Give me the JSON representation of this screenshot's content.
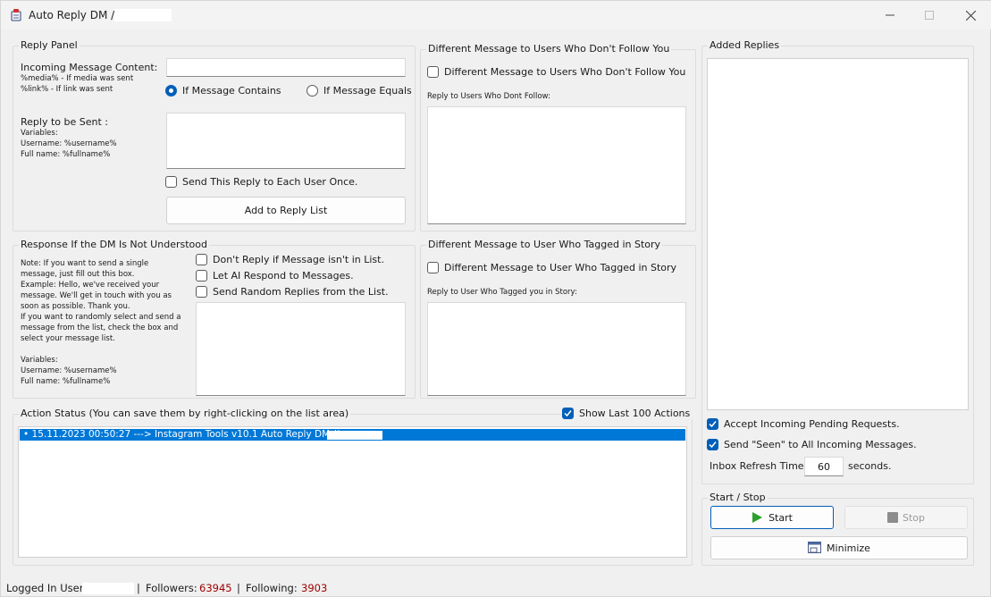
{
  "window": {
    "title": "Auto Reply DM //",
    "minimize_icon": "minimize-icon",
    "maximize_icon": "maximize-icon",
    "close_icon": "close-icon"
  },
  "reply_panel": {
    "title": "Reply Panel",
    "incoming_label": "Incoming Message Content:",
    "incoming_note1": "%media% - If media was sent",
    "incoming_note2": "%link% - If link was sent",
    "incoming_value": "",
    "radio_contains": "If Message Contains",
    "radio_equals": "If Message Equals",
    "radio_selected": "contains",
    "reply_label": "Reply to be Sent :",
    "reply_note1": "Variables:",
    "reply_note2": "Username: %username%",
    "reply_note3": "Full name: %fullname%",
    "reply_value": "",
    "send_once_label": "Send This Reply to Each User Once.",
    "send_once_checked": false,
    "add_button": "Add to Reply List"
  },
  "not_understood": {
    "title": "Response If the DM Is Not Understood",
    "note": [
      "Note: If you want to send a single",
      "message, just fill out this box.",
      "Example: Hello, we've received your",
      "message. We'll get in touch with you as",
      "soon as possible. Thank you.",
      "If you want to randomly select and send a",
      "message from the list, check the box and",
      "select your message list.",
      "",
      "Variables:",
      "Username: %username%",
      "Full name: %fullname%"
    ],
    "opt_dont_reply": "Don't Reply if Message isn't in List.",
    "opt_ai": "Let AI Respond to Messages.",
    "opt_random": "Send Random Replies from the List."
  },
  "non_followers": {
    "title": "Different Message to Users Who Don't Follow You",
    "check_label": "Different Message to Users Who Don't Follow You",
    "field_label": "Reply to Users Who Dont Follow:"
  },
  "tagged_story": {
    "title": "Different Message to User Who Tagged in Story",
    "check_label": "Different Message to User Who Tagged in Story",
    "field_label": "Reply to User Who Tagged you in Story:"
  },
  "added_replies": {
    "title": "Added Replies",
    "accept_pending": "Accept Incoming Pending Requests.",
    "send_seen": "Send \"Seen\" to All Incoming Messages.",
    "refresh_label": "Inbox Refresh Time:",
    "refresh_value": "60",
    "refresh_unit": "seconds."
  },
  "start_stop": {
    "title": "Start / Stop",
    "start": "Start",
    "stop": "Stop",
    "minimize": "Minimize"
  },
  "action_status": {
    "title": "Action Status (You can save them by right-clicking on the list area)",
    "show_last": "Show Last 100 Actions",
    "rows": [
      "15.11.2023 00:50:27 ---> Instagram Tools v10.1 Auto Reply DM //"
    ]
  },
  "status_bar": {
    "logged_label": "Logged In User:",
    "followers_label": "Followers:",
    "followers_value": "63945",
    "following_label": "Following:",
    "following_value": "3903",
    "sep": "|"
  },
  "colors": {
    "accent": "#005fb8",
    "selection": "#0078d7",
    "count_red": "#a00000"
  }
}
